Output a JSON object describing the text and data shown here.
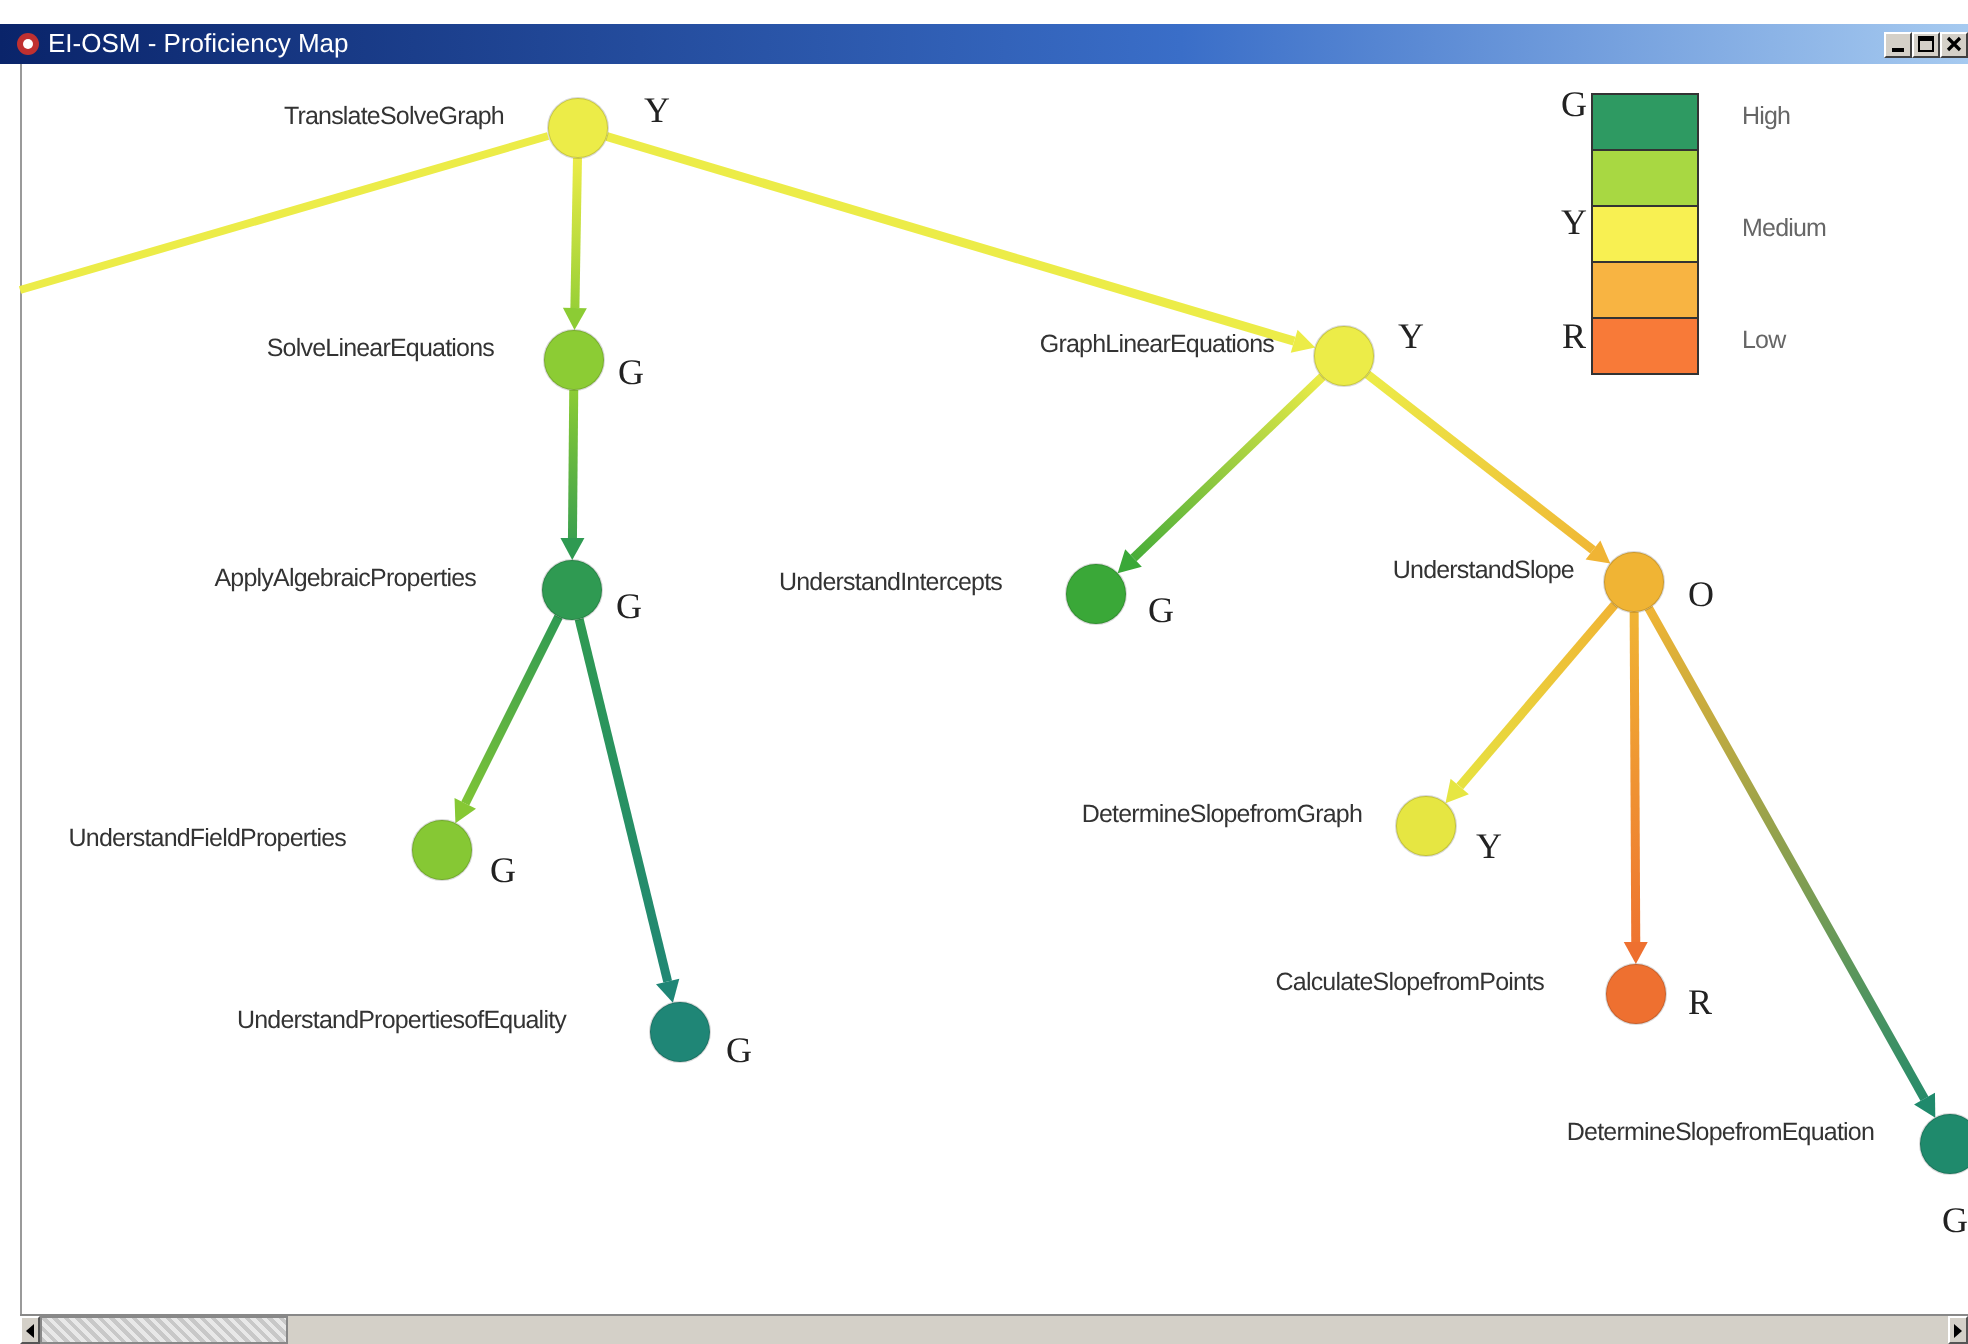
{
  "window": {
    "title": "EI-OSM - Proficiency Map"
  },
  "tree": {
    "label": "TranslateSolveGraph",
    "grade": "Y",
    "color": "#ecec48",
    "children": [
      {
        "label": "SolveLinearEquations",
        "grade": "G",
        "color": "#8ccc34",
        "children": [
          {
            "label": "ApplyAlgebraicProperties",
            "grade": "G",
            "color": "#2f9a52",
            "children": [
              {
                "label": "UnderstandFieldProperties",
                "grade": "G",
                "color": "#86c834"
              },
              {
                "label": "UnderstandPropertiesofEquality",
                "grade": "G",
                "color": "#1f8676"
              }
            ]
          }
        ]
      },
      {
        "label": "GraphLinearEquations",
        "grade": "Y",
        "color": "#ecec48",
        "children": [
          {
            "label": "UnderstandIntercepts",
            "grade": "G",
            "color": "#3aa838"
          },
          {
            "label": "UnderstandSlope",
            "grade": "O",
            "color": "#f0b434",
            "children": [
              {
                "label": "DetermineSlopefromGraph",
                "grade": "Y",
                "color": "#e6e642"
              },
              {
                "label": "CalculateSlopefromPoints",
                "grade": "R",
                "color": "#ee7030"
              },
              {
                "label": "DetermineSlopefromEquation",
                "grade": "G",
                "color": "#1f8a6c"
              }
            ]
          }
        ]
      }
    ]
  },
  "legend": {
    "bands": [
      {
        "color": "#2e9a62"
      },
      {
        "color": "#a8d842"
      },
      {
        "color": "#f8f052"
      },
      {
        "color": "#f8b442"
      },
      {
        "color": "#f87a38"
      }
    ],
    "markers": [
      {
        "letter": "G",
        "label": "High"
      },
      {
        "letter": "Y",
        "label": "Medium"
      },
      {
        "letter": "R",
        "label": "Low"
      }
    ]
  }
}
